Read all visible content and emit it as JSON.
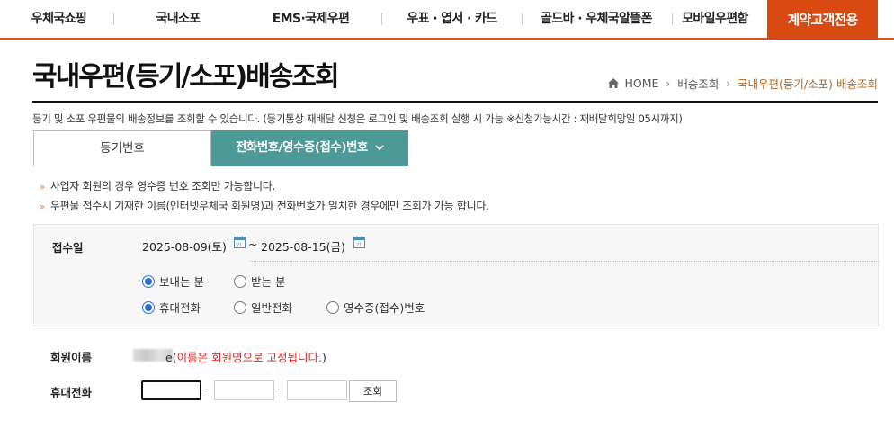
{
  "nav": {
    "items": [
      {
        "label": "우체국쇼핑"
      },
      {
        "label": "국내소포"
      },
      {
        "label": "EMS·국제우편"
      },
      {
        "label": "우표 · 엽서 · 카드"
      },
      {
        "label": "골드바 · 우체국알뜰폰"
      },
      {
        "label": "모바일우편함"
      }
    ],
    "cta_label": "계약고객전용",
    "accent_color": "#d94a12"
  },
  "page": {
    "title": "국내우편(등기/소포)배송조회",
    "intro": "등기 및 소포 우편물의 배송정보를 조회할 수 있습니다. (등기통상 재배달 신청은 로그인 및 배송조회 실행 시 가능 ※신청가능시간 : 재배달희망일 05시까지)"
  },
  "breadcrumb": {
    "home": "HOME",
    "level1": "배송조회",
    "current": "국내우편(등기/소포) 배송조회"
  },
  "tabs": {
    "registered": "등기번호",
    "phone": "전화번호/영수증(접수)번호",
    "active": "phone",
    "active_color": "#4b9a97"
  },
  "notes": [
    "사업자 회원의 경우 영수증 번호 조회만 가능합니다.",
    "우편물 접수시 기재한 이름(인터넷우체국 회원명)과 전화번호가 일치한 경우에만 조회가 가능 합니다."
  ],
  "search": {
    "date_label": "접수일",
    "start_date": "2025-08-09(토)",
    "tilde": "~",
    "end_date": "2025-08-15(금)",
    "role_options": [
      {
        "label": "보내는 분",
        "checked": true
      },
      {
        "label": "받는 분",
        "checked": false
      }
    ],
    "type_options": [
      {
        "label": "휴대전화",
        "checked": true
      },
      {
        "label": "일반전화",
        "checked": false
      },
      {
        "label": "영수증(접수)번호",
        "checked": false
      }
    ]
  },
  "member": {
    "name_label": "회원이름",
    "name_suffix": "e",
    "notice_open": "(",
    "notice_text": "이름은 회원명으로 고정됩니다.",
    "notice_close": ")",
    "phone_label": "휴대전화",
    "phone_dash": "-",
    "phone1": "",
    "phone2": "",
    "phone3": "",
    "lookup_label": "조회"
  }
}
